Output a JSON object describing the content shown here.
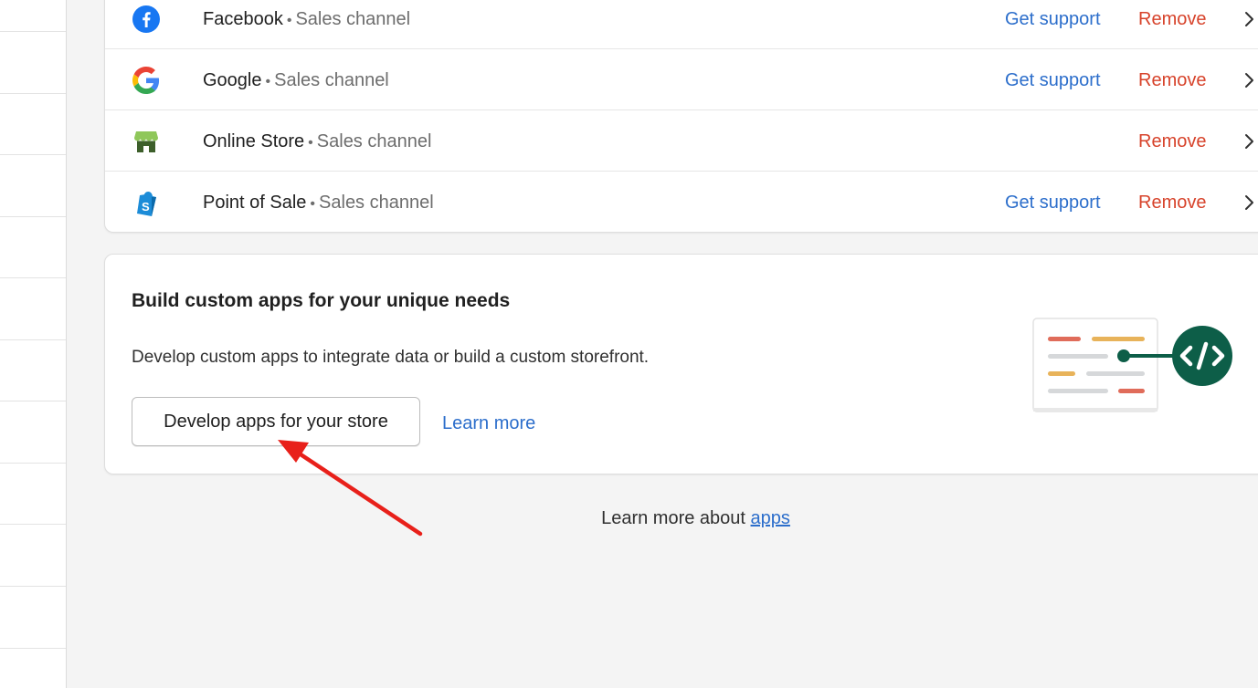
{
  "channels": [
    {
      "name": "Facebook",
      "type": "Sales channel",
      "icon": "facebook-icon",
      "get_support": "Get support",
      "remove": "Remove"
    },
    {
      "name": "Google",
      "type": "Sales channel",
      "icon": "google-icon",
      "get_support": "Get support",
      "remove": "Remove"
    },
    {
      "name": "Online Store",
      "type": "Sales channel",
      "icon": "online-store-icon",
      "get_support": "",
      "remove": "Remove"
    },
    {
      "name": "Point of Sale",
      "type": "Sales channel",
      "icon": "point-of-sale-icon",
      "get_support": "Get support",
      "remove": "Remove"
    }
  ],
  "separator": "•",
  "custom_apps": {
    "title": "Build custom apps for your unique needs",
    "description": "Develop custom apps to integrate data or build a custom storefront.",
    "button_label": "Develop apps for your store",
    "learn_more": "Learn more",
    "illustration": "code-illustration"
  },
  "footer": {
    "prefix": "Learn more about ",
    "link": "apps"
  },
  "colors": {
    "link": "#2c6ecb",
    "remove": "#d7432b",
    "facebook": "#1877f2",
    "online_store": "#5e8e3e",
    "pos": "#1c8cd8",
    "code_badge": "#0d5e48",
    "annotation_arrow": "#e8201a"
  }
}
